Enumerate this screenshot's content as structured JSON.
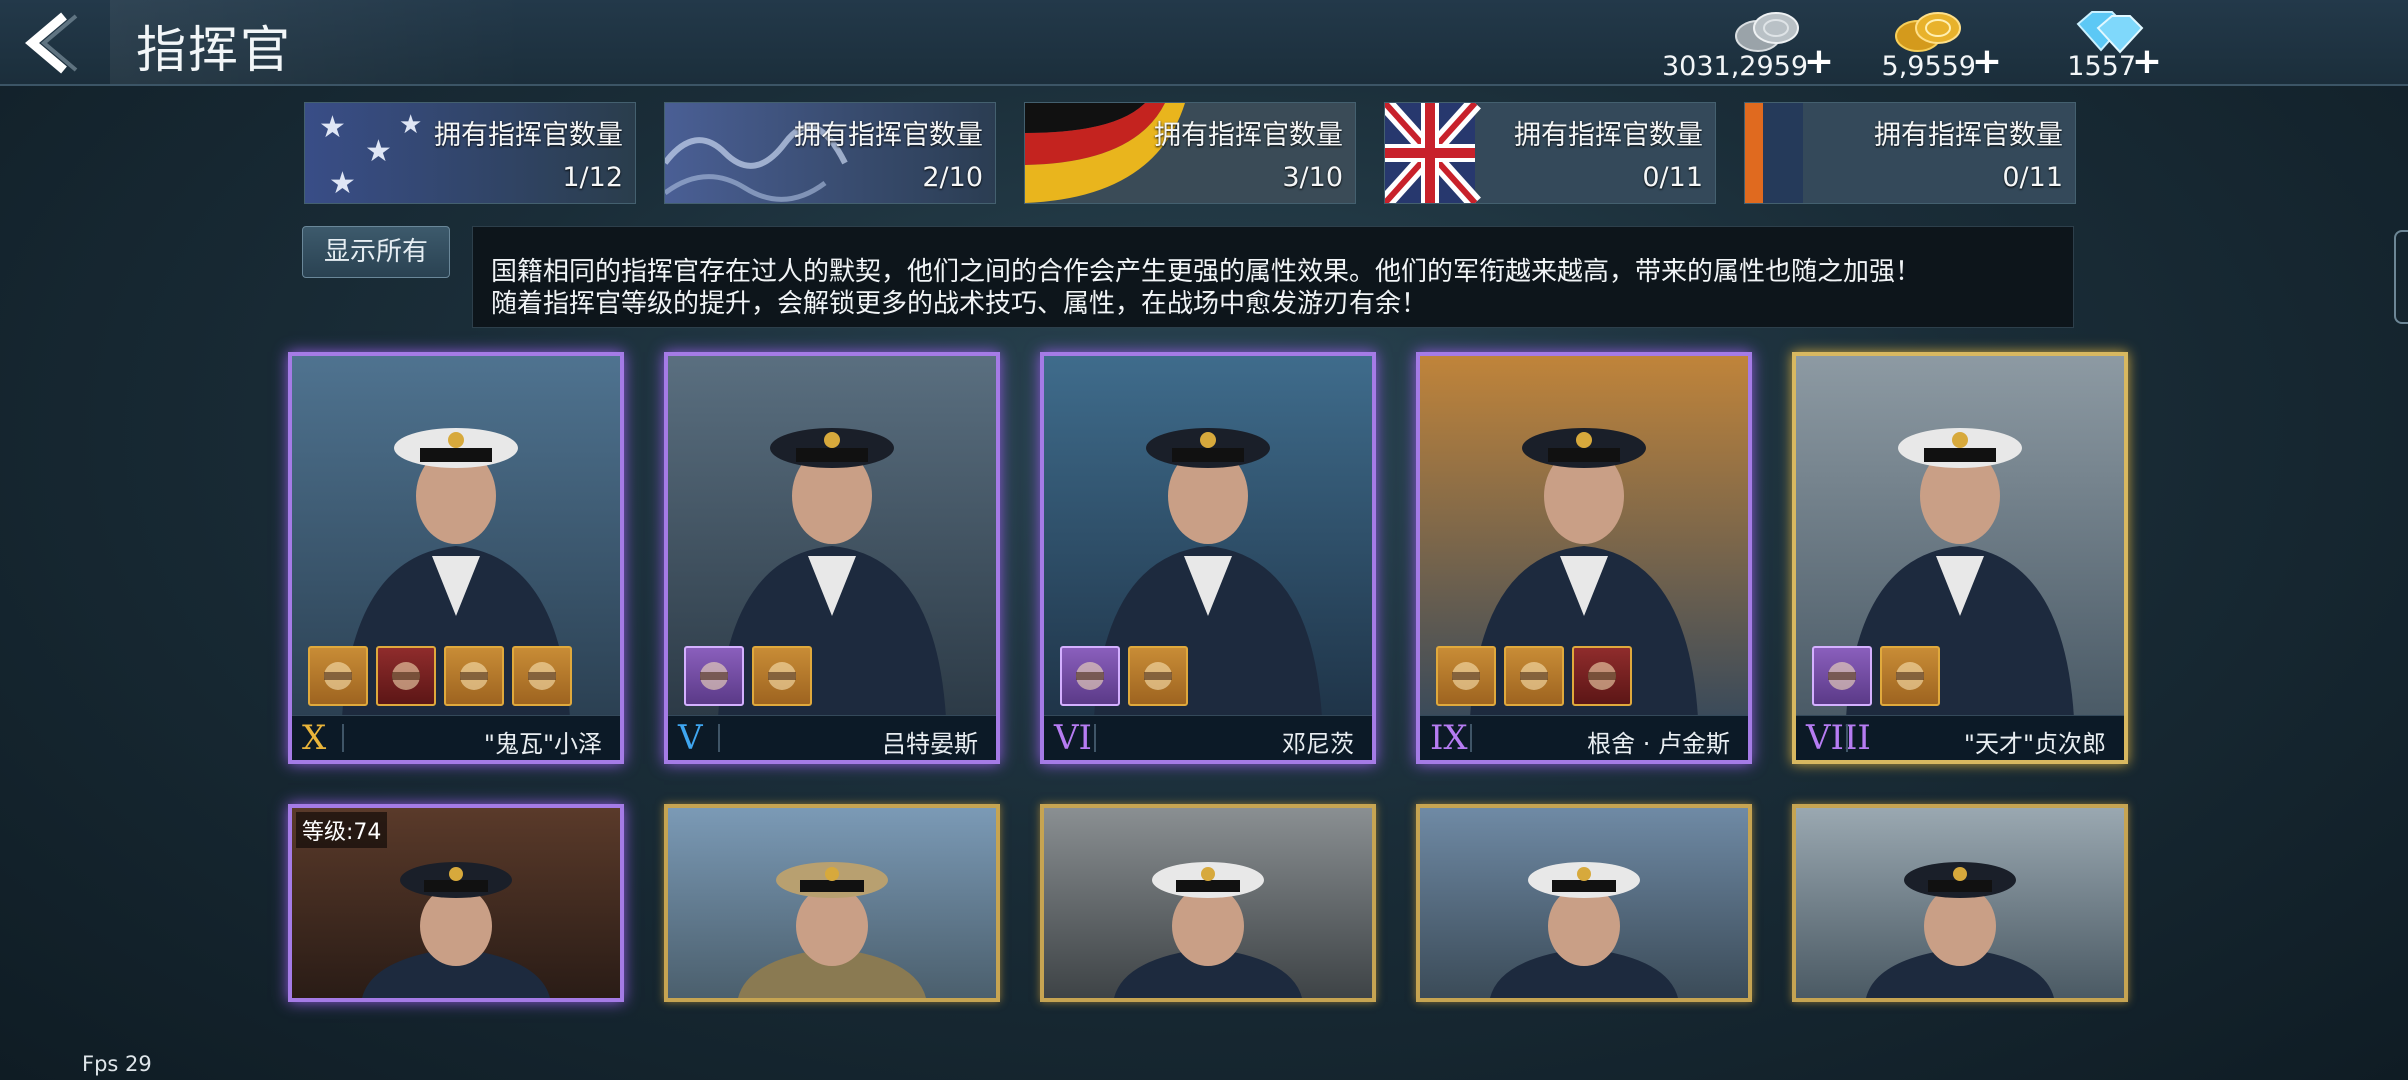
{
  "header": {
    "title": "指挥官"
  },
  "currencies": [
    {
      "name": "silver",
      "amount": "3031,2959",
      "icon": "silver-coins-icon"
    },
    {
      "name": "gold",
      "amount": "5,9559",
      "icon": "gold-coins-icon"
    },
    {
      "name": "diamond",
      "amount": "1557",
      "icon": "diamond-icon"
    }
  ],
  "plus_symbol": "+",
  "nations": [
    {
      "label": "拥有指挥官数量",
      "count": "1/12",
      "flag": "usa"
    },
    {
      "label": "拥有指挥官数量",
      "count": "2/10",
      "flag": "japan"
    },
    {
      "label": "拥有指挥官数量",
      "count": "3/10",
      "flag": "germany"
    },
    {
      "label": "拥有指挥官数量",
      "count": "0/11",
      "flag": "uk"
    },
    {
      "label": "拥有指挥官数量",
      "count": "0/11",
      "flag": "other"
    }
  ],
  "show_all_label": "显示所有",
  "info": {
    "line1": "国籍相同的指挥官存在过人的默契，他们之间的合作会产生更强的属性效果。他们的军衔越来越高，带来的属性也随之加强！",
    "line2": "随着指挥官等级的提升，会解锁更多的战术技巧、属性，在战场中愈发游刃有余！"
  },
  "commanders": [
    {
      "rank": "X",
      "rank_color": "#e9b43a",
      "name": "\"鬼瓦\"小泽",
      "frame": "purple",
      "equipment": [
        "medal-icon",
        "sword-icon",
        "jacket-icon",
        "cap-icon"
      ]
    },
    {
      "rank": "V",
      "rank_color": "#3fa6f0",
      "name": "吕特晏斯",
      "frame": "purple",
      "equipment": [
        "badge-icon",
        "pistol-icon"
      ]
    },
    {
      "rank": "VI",
      "rank_color": "#b67cf2",
      "name": "邓尼茨",
      "frame": "purple",
      "equipment": [
        "cross-medal-icon",
        "baton-icon"
      ]
    },
    {
      "rank": "IX",
      "rank_color": "#b67cf2",
      "name": "根舍 · 卢金斯",
      "frame": "purple",
      "equipment": [
        "order-medal-icon",
        "pistol-icon",
        "armor-icon"
      ]
    },
    {
      "rank": "VIII",
      "rank_color": "#b67cf2",
      "name": "\"天才\"贞次郎",
      "frame": "gold",
      "equipment": [
        "wings-badge-icon",
        "pistol-icon"
      ]
    }
  ],
  "second_row": [
    {
      "frame": "purple",
      "level": "等级:74"
    },
    {
      "frame": "gold"
    },
    {
      "frame": "gold"
    },
    {
      "frame": "gold"
    },
    {
      "frame": "gold"
    }
  ],
  "fps": "Fps 29"
}
